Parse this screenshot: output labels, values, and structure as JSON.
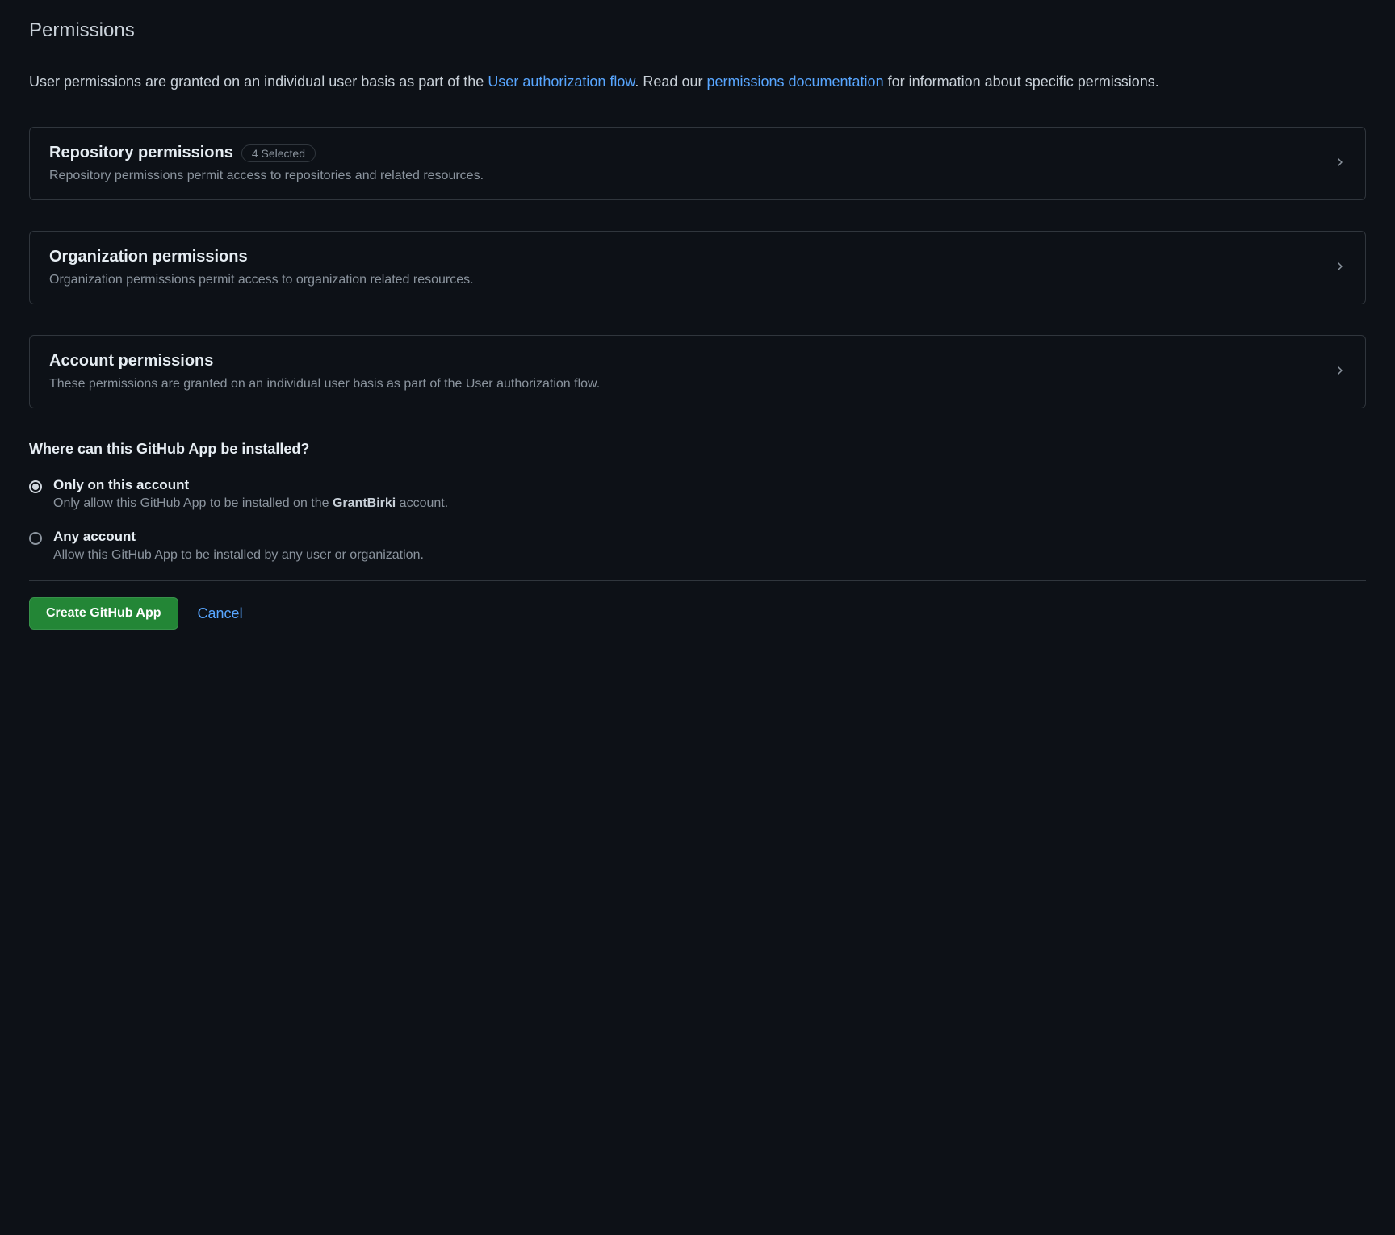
{
  "section_title": "Permissions",
  "description": {
    "text1": "User permissions are granted on an individual user basis as part of the ",
    "link1": "User authorization flow",
    "text2": ". Read our ",
    "link2": "permissions documentation",
    "text3": " for information about specific permissions."
  },
  "permissions": {
    "repository": {
      "title": "Repository permissions",
      "badge": "4 Selected",
      "desc": "Repository permissions permit access to repositories and related resources."
    },
    "organization": {
      "title": "Organization permissions",
      "desc": "Organization permissions permit access to organization related resources."
    },
    "account": {
      "title": "Account permissions",
      "desc": "These permissions are granted on an individual user basis as part of the User authorization flow."
    }
  },
  "install": {
    "heading": "Where can this GitHub App be installed?",
    "only": {
      "label": "Only on this account",
      "desc_prefix": "Only allow this GitHub App to be installed on the ",
      "account": "GrantBirki",
      "desc_suffix": " account."
    },
    "any": {
      "label": "Any account",
      "desc": "Allow this GitHub App to be installed by any user or organization."
    }
  },
  "footer": {
    "create": "Create GitHub App",
    "cancel": "Cancel"
  }
}
